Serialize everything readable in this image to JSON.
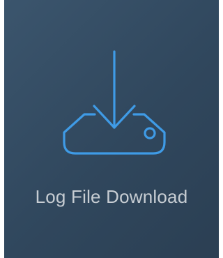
{
  "tile": {
    "label": "Log File Download",
    "icon": "download-to-drive-icon",
    "background_color": "#34495e",
    "icon_color": "#3f9be6",
    "label_color": "#c7cdd3"
  }
}
